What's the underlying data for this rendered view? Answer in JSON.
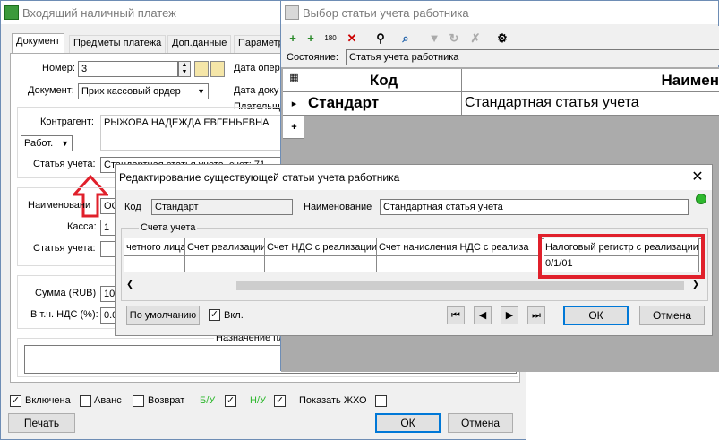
{
  "main_window": {
    "title": "Входящий наличный платеж",
    "tabs": [
      "Документ",
      "Предметы платежа",
      "Доп.данные",
      "Параметр"
    ],
    "number_label": "Номер:",
    "number_value": "3",
    "doc_label": "Документ:",
    "doc_value": "Прих кассовый ордер",
    "date_oper_label": "Дата опер",
    "date_doc_label": "Дата доку",
    "payer_label": "Плательщ",
    "counterparty_label": "Контрагент:",
    "counterparty_value": "РЫЖОВА НАДЕЖДА ЕВГЕНЬЕВНА",
    "type_select": "Работ.",
    "account_item_label": "Статья учета:",
    "account_item_value": "Стандартная статья учета, счет: 71",
    "name_label": "Наименовани",
    "name_value": "ОС",
    "cash_label": "Касса:",
    "cash_value": "1",
    "account_item2_label": "Статья учета:",
    "sum_label": "Сумма (RUB)",
    "sum_value": "10",
    "vat_label": "В т.ч. НДС (%):",
    "vat_value": "0.0",
    "purpose_label": "Назначение пл",
    "bottom": {
      "included": "Включена",
      "advance": "Аванс",
      "return": "Возврат",
      "bu": "Б/У",
      "nu": "Н/У",
      "show_zho": "Показать ЖХО"
    },
    "print_btn": "Печать",
    "ok_btn": "ОК",
    "cancel_btn": "Отмена"
  },
  "select_window": {
    "title": "Выбор статьи учета работника",
    "toolbar_text": "180",
    "status_label": "Состояние:",
    "status_value": "Статья учета работника",
    "col_code": "Код",
    "col_name": "Наимен",
    "row_code": "Стандарт",
    "row_name": "Стандартная статья учета",
    "add_row": "+"
  },
  "edit_dialog": {
    "title": "Редактирование существующей статьи учета работника",
    "code_label": "Код",
    "code_value": "Стандарт",
    "name_label": "Наименование",
    "name_value": "Стандартная статья учета",
    "accounts_label": "Счета учета",
    "columns": [
      "четного лица",
      "Счет реализации",
      "Счет НДС с реализации",
      "Счет начисления НДС с реализа",
      "Налоговый регистр с реализации"
    ],
    "tax_value": "0/1/01",
    "default_btn": "По умолчанию",
    "incl_label": "Вкл.",
    "ok_btn": "ОК",
    "cancel_btn": "Отмена"
  },
  "colors": {
    "highlight_red": "#e0202b",
    "indicator_green": "#2eb82e",
    "accent_blue": "#0078d7"
  }
}
